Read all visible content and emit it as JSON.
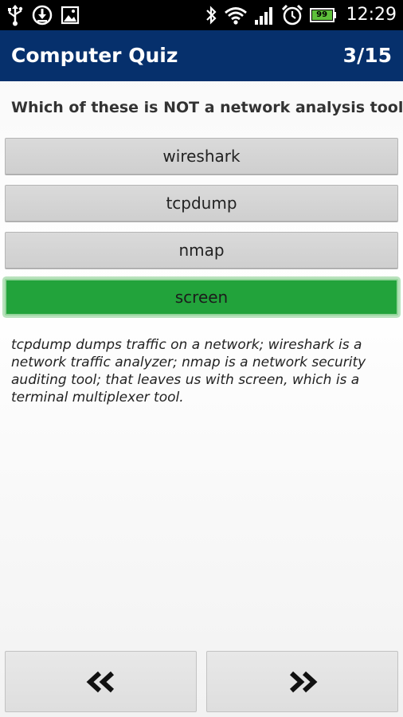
{
  "status_bar": {
    "time": "12:29",
    "battery_level": "99",
    "icons": [
      "usb-icon",
      "download-icon",
      "image-icon",
      "bluetooth-icon",
      "wifi-icon",
      "signal-icon",
      "alarm-icon",
      "battery-icon"
    ]
  },
  "app_bar": {
    "title": "Computer Quiz",
    "counter": "3/15",
    "color": "#06306c"
  },
  "question": {
    "text": "Which of these is NOT a network analysis tool?"
  },
  "answers": [
    {
      "label": "wireshark",
      "state": "default"
    },
    {
      "label": "tcpdump",
      "state": "default"
    },
    {
      "label": "nmap",
      "state": "default"
    },
    {
      "label": "screen",
      "state": "correct",
      "color": "#22a33b"
    }
  ],
  "explanation": {
    "text": "tcpdump dumps traffic on a network; wireshark is a network traffic analyzer; nmap is a network security auditing tool; that leaves us with screen, which is a terminal multiplexer tool."
  },
  "navigation": {
    "prev_icon": "double-chevron-left-icon",
    "next_icon": "double-chevron-right-icon"
  }
}
